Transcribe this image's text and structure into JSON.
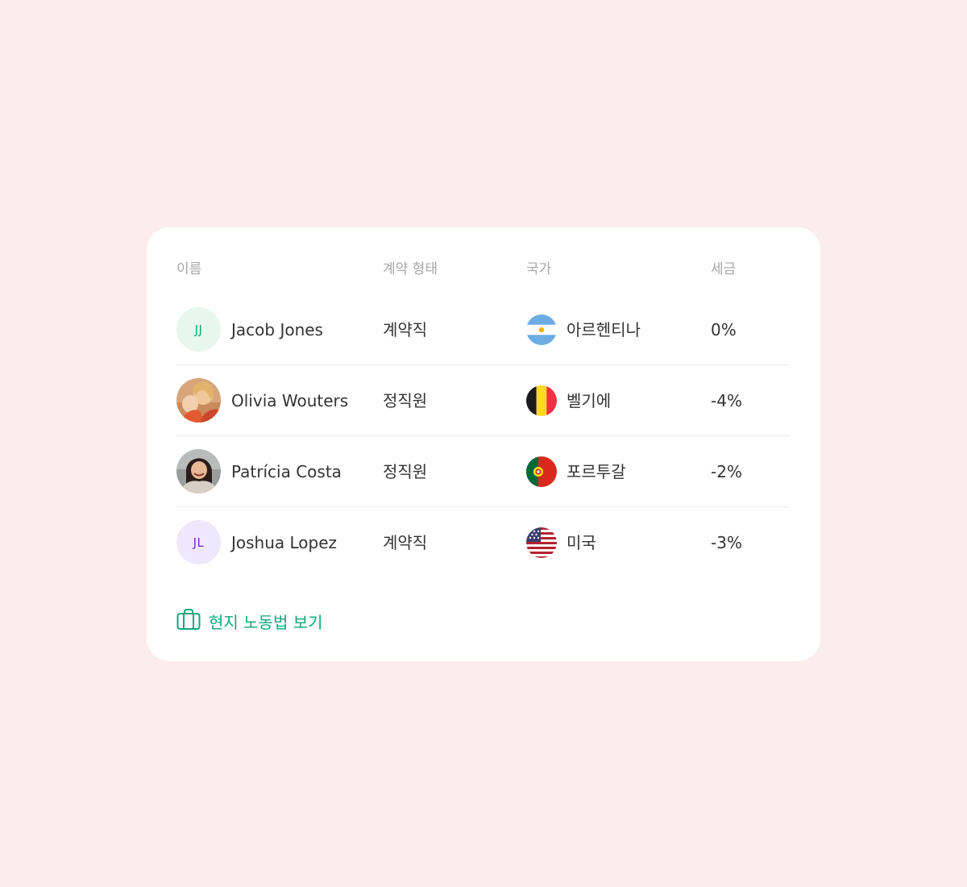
{
  "table": {
    "headers": {
      "name": "이름",
      "contract": "계약 형태",
      "country": "국가",
      "tax": "세금"
    },
    "rows": [
      {
        "initials": "JJ",
        "name": "Jacob Jones",
        "contract": "계약직",
        "country": "아르헨티나",
        "tax": "0%"
      },
      {
        "initials": "",
        "name": "Olivia Wouters",
        "contract": "정직원",
        "country": "벨기에",
        "tax": "-4%"
      },
      {
        "initials": "",
        "name": "Patrícia Costa",
        "contract": "정직원",
        "country": "포르투갈",
        "tax": "-2%"
      },
      {
        "initials": "JL",
        "name": "Joshua Lopez",
        "contract": "계약직",
        "country": "미국",
        "tax": "-3%"
      }
    ]
  },
  "footer": {
    "link_label": "현지 노동법 보기",
    "icon": "briefcase-icon"
  },
  "colors": {
    "background": "#fbecee",
    "card": "#ffffff",
    "accent": "#12a87a",
    "jj_avatar_bg": "#e7f7ef",
    "jj_avatar_text": "#12a87a",
    "jl_avatar_bg": "#efe7fb",
    "jl_avatar_text": "#7a2fc4"
  }
}
